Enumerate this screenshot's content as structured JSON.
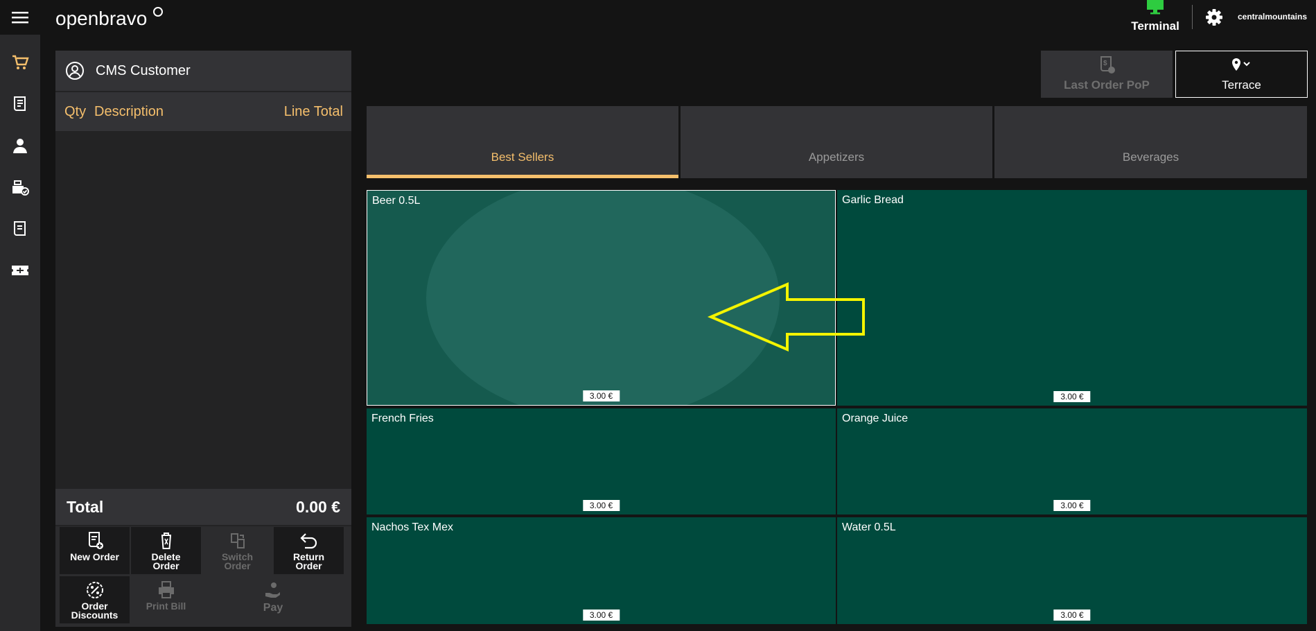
{
  "header": {
    "logo_text": "openbravo",
    "terminal_label": "Terminal",
    "user_name": "centralmountains"
  },
  "colors": {
    "accent": "#f5bf6c",
    "product_tile": "#004a3d",
    "terminal_icon": "#2ecc40"
  },
  "sidebar": {
    "items": [
      {
        "icon": "cart-icon"
      },
      {
        "icon": "receipt-icon"
      },
      {
        "icon": "person-icon"
      },
      {
        "icon": "cash-register-check-icon"
      },
      {
        "icon": "document-icon"
      },
      {
        "icon": "ticket-icon"
      }
    ]
  },
  "order": {
    "customer_name": "CMS Customer",
    "col_qty": "Qty",
    "col_description": "Description",
    "col_line_total": "Line Total",
    "total_label": "Total",
    "total_value": "0.00 €"
  },
  "actions": {
    "new_order": [
      "New Order"
    ],
    "delete_order": [
      "Delete",
      "Order"
    ],
    "switch_order": [
      "Switch",
      "Order"
    ],
    "return_order": [
      "Return",
      "Order"
    ],
    "order_discounts": [
      "Order",
      "Discounts"
    ],
    "print_bill": "Print Bill",
    "pay": "Pay"
  },
  "toolbar": {
    "last_order_pop": "Last Order PoP",
    "location": "Terrace"
  },
  "categories": [
    {
      "label": "Best Sellers",
      "active": true
    },
    {
      "label": "Appetizers",
      "active": false
    },
    {
      "label": "Beverages",
      "active": false
    }
  ],
  "products": [
    {
      "name": "Beer 0.5L",
      "price": "3.00 €"
    },
    {
      "name": "Garlic Bread",
      "price": "3.00 €"
    },
    {
      "name": "French Fries",
      "price": "3.00 €"
    },
    {
      "name": "Orange Juice",
      "price": "3.00 €"
    },
    {
      "name": "Nachos Tex Mex",
      "price": "3.00 €"
    },
    {
      "name": "Water 0.5L",
      "price": "3.00 €"
    }
  ]
}
